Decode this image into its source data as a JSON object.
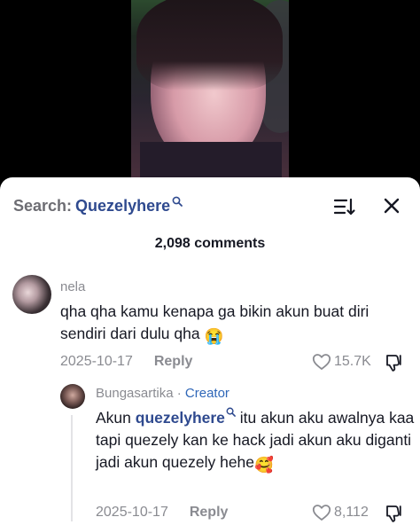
{
  "search": {
    "prefix": "Search:",
    "term": "Quezelyhere"
  },
  "comments_count": "2,098 comments",
  "comments": [
    {
      "username": "nela",
      "text_before": "qha qha kamu kenapa ga bikin akun buat diri sendiri dari dulu qha",
      "emoji": "😭",
      "date": "2025-10-17",
      "reply_label": "Reply",
      "likes": "15.7K"
    }
  ],
  "reply": {
    "username": "Bungasartika",
    "separator": " · ",
    "creator_label": "Creator",
    "prefix": "Akun ",
    "mention": "quezelyhere",
    "text_after": " itu akun aku awalnya kaa tapi quezely kan ke hack jadi akun aku diganti jadi akun quezely hehe",
    "emoji": "🥰",
    "date": "2025-10-17",
    "reply_label": "Reply",
    "likes": "8,112"
  },
  "icons": {
    "search": "search-icon",
    "sort": "sort-icon",
    "close": "close-icon",
    "heart": "heart-icon",
    "dislike": "dislike-icon"
  },
  "colors": {
    "accent_blue": "#2f4a8f",
    "creator_blue": "#2f67b8",
    "muted_gray": "#8a8b91",
    "text_dark": "#161823"
  }
}
